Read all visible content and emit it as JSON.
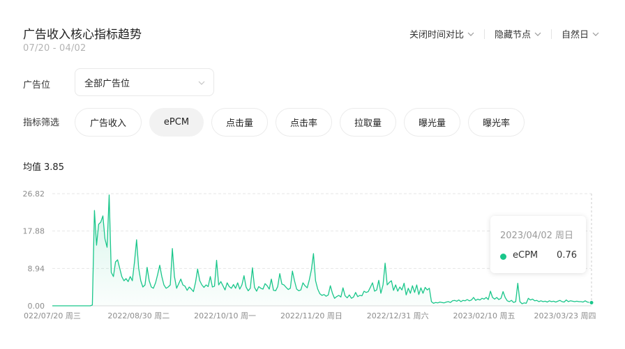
{
  "header": {
    "title": "广告收入核心指标趋势",
    "date_range": "07/20 - 04/02",
    "controls": [
      {
        "label": "关闭时间对比"
      },
      {
        "label": "隐藏节点"
      },
      {
        "label": "自然日"
      }
    ]
  },
  "filters": {
    "placement_label": "广告位",
    "placement_value": "全部广告位",
    "metric_label": "指标筛选",
    "metrics": [
      "广告收入",
      "ePCM",
      "点击量",
      "点击率",
      "拉取量",
      "曝光量",
      "曝光率"
    ],
    "active_metric": "ePCM"
  },
  "summary": {
    "avg_label": "均值",
    "avg_value": "3.85"
  },
  "tooltip": {
    "date": "2023/04/02 周日",
    "series_name": "eCPM",
    "value": "0.76"
  },
  "colors": {
    "line": "#19c68a",
    "grid": "#e6e6e6",
    "axis_text": "#8c8c8c"
  },
  "chart_data": {
    "type": "area",
    "y_ticks": [
      "0.00",
      "8.94",
      "17.88",
      "26.82"
    ],
    "ylim": [
      0,
      26.82
    ],
    "x_tick_labels": [
      "022/07/20 周三",
      "2022/08/30 周二",
      "2022/10/10 周一",
      "2022/11/20 周日",
      "2022/12/31 周六",
      "2023/02/10 周五",
      "2023/03/23 周四"
    ],
    "x_tick_days": [
      0,
      41,
      82,
      123,
      164,
      205,
      246
    ],
    "total_days": 256,
    "series": [
      {
        "name": "eCPM",
        "points": [
          [
            0,
            0
          ],
          [
            10,
            0
          ],
          [
            18,
            0
          ],
          [
            19,
            0.2
          ],
          [
            20,
            22.8
          ],
          [
            21,
            14.5
          ],
          [
            22,
            19.5
          ],
          [
            23,
            20
          ],
          [
            24,
            21.5
          ],
          [
            25,
            16
          ],
          [
            26,
            14
          ],
          [
            27,
            26.5
          ],
          [
            28,
            8
          ],
          [
            29,
            7
          ],
          [
            30,
            10.5
          ],
          [
            31,
            11
          ],
          [
            32,
            9
          ],
          [
            33,
            7
          ],
          [
            34,
            6
          ],
          [
            35,
            6.5
          ],
          [
            36,
            5.8
          ],
          [
            37,
            7
          ],
          [
            38,
            6
          ],
          [
            39,
            10.5
          ],
          [
            40,
            15.8
          ],
          [
            41,
            9
          ],
          [
            42,
            6
          ],
          [
            43,
            4.5
          ],
          [
            44,
            5
          ],
          [
            45,
            9.2
          ],
          [
            46,
            6
          ],
          [
            47,
            4.5
          ],
          [
            48,
            4.2
          ],
          [
            49,
            5.5
          ],
          [
            50,
            7.5
          ],
          [
            51,
            9.7
          ],
          [
            52,
            7
          ],
          [
            53,
            5
          ],
          [
            54,
            4.2
          ],
          [
            55,
            4.5
          ],
          [
            56,
            5
          ],
          [
            57,
            13.7
          ],
          [
            58,
            7
          ],
          [
            59,
            4.2
          ],
          [
            60,
            5.3
          ],
          [
            61,
            6.4
          ],
          [
            62,
            5
          ],
          [
            63,
            4.7
          ],
          [
            64,
            3.7
          ],
          [
            65,
            4.5
          ],
          [
            66,
            4
          ],
          [
            67,
            3.4
          ],
          [
            68,
            5.6
          ],
          [
            69,
            8.8
          ],
          [
            70,
            6
          ],
          [
            71,
            5
          ],
          [
            72,
            4.4
          ],
          [
            73,
            5
          ],
          [
            74,
            4.6
          ],
          [
            75,
            7
          ],
          [
            76,
            4.5
          ],
          [
            77,
            4.7
          ],
          [
            78,
            10.9
          ],
          [
            79,
            5
          ],
          [
            80,
            5.8
          ],
          [
            81,
            4.8
          ],
          [
            82,
            3.8
          ],
          [
            83,
            5.5
          ],
          [
            84,
            4.6
          ],
          [
            85,
            4.2
          ],
          [
            86,
            5.1
          ],
          [
            87,
            4.2
          ],
          [
            88,
            5.5
          ],
          [
            89,
            4
          ],
          [
            90,
            5
          ],
          [
            91,
            7.2
          ],
          [
            92,
            4.5
          ],
          [
            93,
            3.6
          ],
          [
            94,
            4.2
          ],
          [
            95,
            9.1
          ],
          [
            96,
            4.4
          ],
          [
            97,
            3.5
          ],
          [
            98,
            4.6
          ],
          [
            99,
            4.2
          ],
          [
            100,
            4
          ],
          [
            101,
            5.3
          ],
          [
            102,
            4.8
          ],
          [
            103,
            4
          ],
          [
            104,
            6.4
          ],
          [
            105,
            3.7
          ],
          [
            106,
            3.6
          ],
          [
            107,
            4.6
          ],
          [
            108,
            7.7
          ],
          [
            109,
            5.2
          ],
          [
            110,
            5
          ],
          [
            111,
            4.4
          ],
          [
            112,
            3.9
          ],
          [
            113,
            4.2
          ],
          [
            114,
            8.3
          ],
          [
            115,
            6
          ],
          [
            116,
            4
          ],
          [
            117,
            3.6
          ],
          [
            118,
            3.8
          ],
          [
            119,
            5.5
          ],
          [
            120,
            4.8
          ],
          [
            121,
            4.3
          ],
          [
            122,
            6.2
          ],
          [
            123,
            8.6
          ],
          [
            124,
            12.5
          ],
          [
            125,
            6
          ],
          [
            126,
            4
          ],
          [
            127,
            2.9
          ],
          [
            128,
            2.5
          ],
          [
            129,
            2.7
          ],
          [
            130,
            2.3
          ],
          [
            131,
            2.6
          ],
          [
            132,
            4.8
          ],
          [
            133,
            3
          ],
          [
            134,
            1.8
          ],
          [
            135,
            2.2
          ],
          [
            136,
            2.5
          ],
          [
            137,
            2.1
          ],
          [
            138,
            4.3
          ],
          [
            139,
            2.4
          ],
          [
            140,
            1.9
          ],
          [
            141,
            2.6
          ],
          [
            142,
            1.8
          ],
          [
            143,
            2.1
          ],
          [
            144,
            3.2
          ],
          [
            145,
            2.2
          ],
          [
            146,
            2.5
          ],
          [
            147,
            2.4
          ],
          [
            148,
            3.5
          ],
          [
            149,
            3.2
          ],
          [
            150,
            3.4
          ],
          [
            151,
            4.4
          ],
          [
            152,
            5.5
          ],
          [
            153,
            3.5
          ],
          [
            154,
            3.8
          ],
          [
            155,
            6.1
          ],
          [
            156,
            3
          ],
          [
            157,
            5
          ],
          [
            158,
            10.2
          ],
          [
            159,
            5
          ],
          [
            160,
            5.6
          ],
          [
            161,
            6
          ],
          [
            162,
            3.7
          ],
          [
            163,
            5
          ],
          [
            164,
            3.5
          ],
          [
            165,
            4.5
          ],
          [
            166,
            3.8
          ],
          [
            167,
            5.4
          ],
          [
            168,
            2.6
          ],
          [
            169,
            4.2
          ],
          [
            170,
            3
          ],
          [
            171,
            4.8
          ],
          [
            172,
            3.2
          ],
          [
            173,
            5
          ],
          [
            174,
            2.7
          ],
          [
            175,
            4.3
          ],
          [
            176,
            3
          ],
          [
            177,
            4.4
          ],
          [
            178,
            3.8
          ],
          [
            179,
            4.2
          ],
          [
            180,
            1
          ],
          [
            181,
            0.6
          ],
          [
            182,
            0.8
          ],
          [
            183,
            0.7
          ],
          [
            184,
            0.9
          ],
          [
            185,
            0.8
          ],
          [
            186,
            0.7
          ],
          [
            187,
            0.9
          ],
          [
            188,
            1
          ],
          [
            189,
            0.8
          ],
          [
            190,
            1.2
          ],
          [
            191,
            1.3
          ],
          [
            192,
            1.1
          ],
          [
            193,
            1.4
          ],
          [
            194,
            1
          ],
          [
            195,
            1.3
          ],
          [
            196,
            1.2
          ],
          [
            197,
            1.5
          ],
          [
            198,
            1.2
          ],
          [
            199,
            1.4
          ],
          [
            200,
            2
          ],
          [
            201,
            1.3
          ],
          [
            202,
            1.6
          ],
          [
            203,
            1.4
          ],
          [
            204,
            1.8
          ],
          [
            205,
            1.6
          ],
          [
            206,
            2
          ],
          [
            207,
            1.5
          ],
          [
            208,
            3.5
          ],
          [
            209,
            2
          ],
          [
            210,
            1.6
          ],
          [
            211,
            2
          ],
          [
            212,
            1.5
          ],
          [
            213,
            1.8
          ],
          [
            214,
            3.4
          ],
          [
            215,
            2
          ],
          [
            216,
            1.2
          ],
          [
            217,
            1
          ],
          [
            218,
            1.3
          ],
          [
            219,
            0.8
          ],
          [
            220,
            1
          ],
          [
            221,
            5.4
          ],
          [
            222,
            1
          ],
          [
            223,
            0.5
          ],
          [
            224,
            0.7
          ],
          [
            225,
            0.6
          ],
          [
            226,
            1.8
          ],
          [
            227,
            1.4
          ],
          [
            228,
            1.6
          ],
          [
            229,
            1.2
          ],
          [
            230,
            1.3
          ],
          [
            231,
            1
          ],
          [
            232,
            1.2
          ],
          [
            233,
            1
          ],
          [
            234,
            1.1
          ],
          [
            235,
            0.9
          ],
          [
            236,
            1.2
          ],
          [
            237,
            1
          ],
          [
            238,
            1.1
          ],
          [
            239,
            0.9
          ],
          [
            240,
            1.1
          ],
          [
            241,
            1.3
          ],
          [
            242,
            1
          ],
          [
            243,
            0.9
          ],
          [
            244,
            1.4
          ],
          [
            245,
            1
          ],
          [
            246,
            1.2
          ],
          [
            247,
            1.1
          ],
          [
            248,
            1
          ],
          [
            249,
            1.1
          ],
          [
            250,
            1
          ],
          [
            251,
            1
          ],
          [
            252,
            0.9
          ],
          [
            253,
            1.2
          ],
          [
            254,
            0.9
          ],
          [
            255,
            0.8
          ],
          [
            256,
            0.76
          ]
        ]
      }
    ],
    "grid": true,
    "legend": "none"
  }
}
